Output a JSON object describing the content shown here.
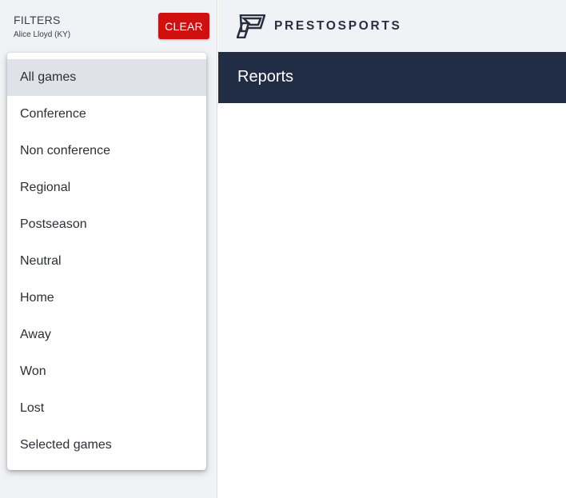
{
  "sidebar": {
    "title": "FILTERS",
    "subtitle": "Alice Lloyd (KY)",
    "clear_label": "CLEAR"
  },
  "menu": {
    "selected": "All games",
    "items": [
      {
        "label": "All games"
      },
      {
        "label": "Conference"
      },
      {
        "label": "Non conference"
      },
      {
        "label": "Regional"
      },
      {
        "label": "Postseason"
      },
      {
        "label": "Neutral"
      },
      {
        "label": "Home"
      },
      {
        "label": "Away"
      },
      {
        "label": "Won"
      },
      {
        "label": "Lost"
      },
      {
        "label": "Selected games"
      }
    ]
  },
  "header": {
    "logo_icon": "prestosports-logo-icon",
    "brand": "PRESTOSPORTS"
  },
  "report": {
    "title": "Reports"
  },
  "colors": {
    "clear_button": "#d00f0f",
    "report_bar": "#212c45",
    "sidebar_bg": "#f0f2f5",
    "selected_item_bg": "#dfe2e8",
    "brand_text": "#283040"
  }
}
